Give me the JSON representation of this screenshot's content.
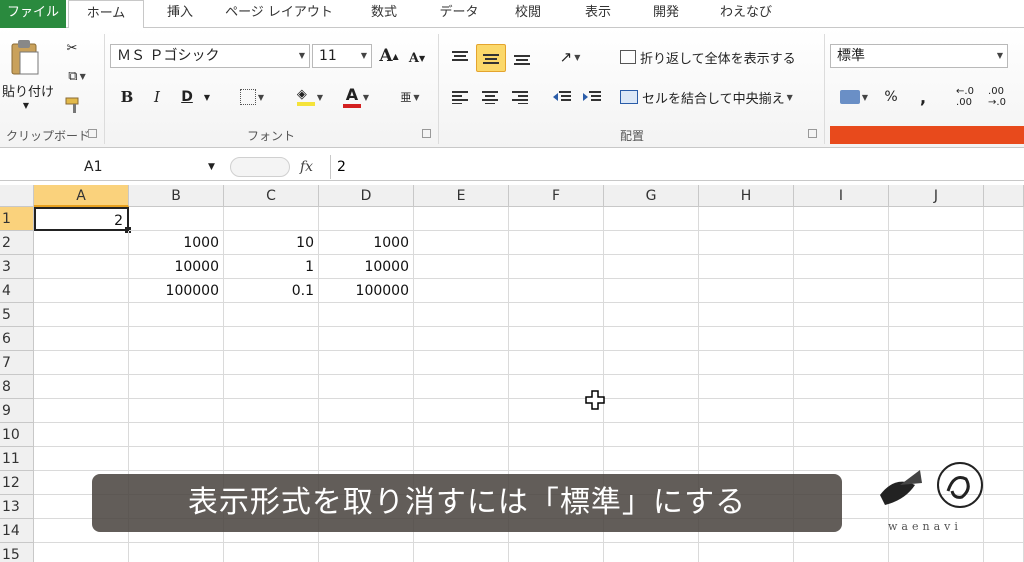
{
  "tabs": [
    "ファイル",
    "ホーム",
    "挿入",
    "ページ レイアウト",
    "数式",
    "データ",
    "校閲",
    "表示",
    "開発",
    "わえなび"
  ],
  "ribbon": {
    "clipboard": {
      "paste_label": "貼り付け",
      "group_label": "クリップボード"
    },
    "font": {
      "font_name": "ＭＳ Ｐゴシック",
      "font_size": "11",
      "grow_label": "A",
      "shrink_label": "A",
      "bold": "B",
      "italic": "I",
      "underline": "D",
      "font_color_label": "A",
      "group_label": "フォント"
    },
    "alignment": {
      "wrap_label": "折り返して全体を表示する",
      "merge_label": "セルを結合して中央揃え",
      "group_label": "配置"
    },
    "number": {
      "format_value": "標準",
      "percent": "%",
      "comma": ","
    }
  },
  "formula_bar": {
    "name_box": "A1",
    "fx": "fx",
    "value": "2"
  },
  "sheet": {
    "columns": [
      "A",
      "B",
      "C",
      "D",
      "E",
      "F",
      "G",
      "H",
      "I",
      "J"
    ],
    "rows": [
      "1",
      "2",
      "3",
      "4",
      "5",
      "6",
      "7",
      "8",
      "9",
      "10",
      "11",
      "12",
      "13",
      "14",
      "15"
    ],
    "cells": {
      "A1": "2",
      "B2": "1000",
      "C2": "10",
      "D2": "1000",
      "B3": "10000",
      "C3": "1",
      "D3": "10000",
      "B4": "100000",
      "C4": "0.1",
      "D4": "100000"
    }
  },
  "caption": "表示形式を取り消すには「標準」にする",
  "logo": {
    "text": "waenavi"
  },
  "colors": {
    "file_tab": "#2a8a3e",
    "selection": "#fbd86a",
    "header_active": "#fad27c",
    "accent_bar": "#e84a1c"
  }
}
